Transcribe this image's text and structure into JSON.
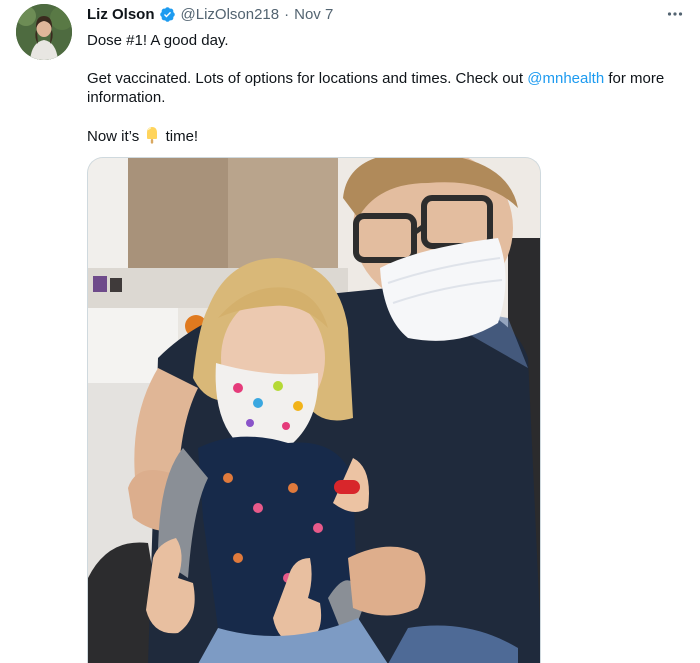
{
  "tweet": {
    "author_name": "Liz Olson",
    "handle": "@LizOlson218",
    "separator": "·",
    "timestamp": "Nov 7",
    "verified": true,
    "more_label": "More",
    "line1": "Dose #1! A good day.",
    "line2_before": "Get vaccinated. Lots of options for locations and times. Check out ",
    "mention": "@mnhealth",
    "line2_after": " for more information.",
    "line3_before": "Now it’s ",
    "emoji_name": "popsicle-emoji",
    "line3_after": " time!",
    "photo_description_name": "vaccination-photo"
  },
  "colors": {
    "link": "#1d9bf0",
    "secondary_text": "#536471",
    "primary_text": "#0f1419",
    "verified_badge": "#1d9bf0"
  }
}
